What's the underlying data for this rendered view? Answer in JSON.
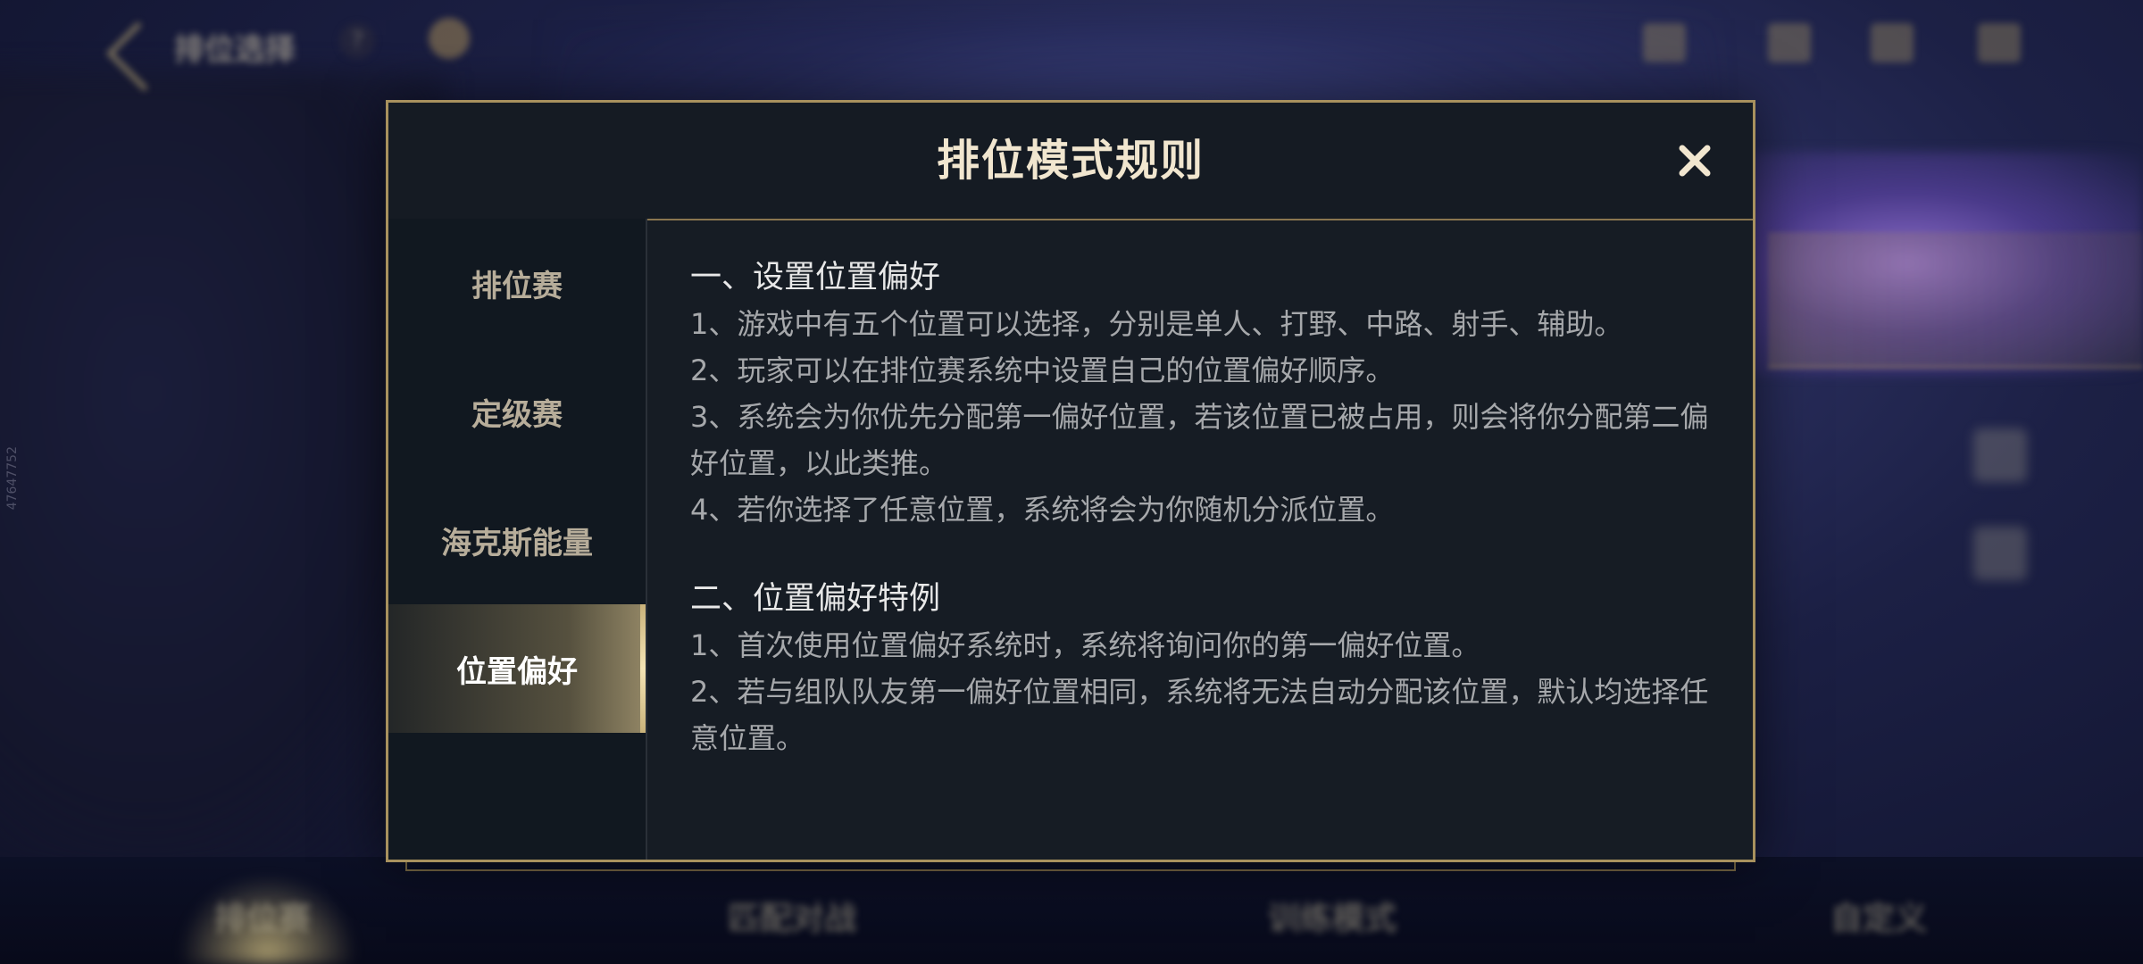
{
  "background": {
    "top_bar": {
      "title": "排位选择",
      "help_label": "?"
    },
    "bottom_nav": [
      "排位赛",
      "匹配对战",
      "训练模式",
      "自定义"
    ],
    "side_id": "47647752"
  },
  "modal": {
    "title": "排位模式规则",
    "close_icon": "close-icon",
    "tabs": [
      {
        "label": "排位赛"
      },
      {
        "label": "定级赛"
      },
      {
        "label": "海克斯能量"
      },
      {
        "label": "位置偏好"
      }
    ],
    "active_tab": "位置偏好",
    "sections": [
      {
        "heading": "一、设置位置偏好",
        "lines": [
          "1、游戏中有五个位置可以选择，分别是单人、打野、中路、射手、辅助。",
          "2、玩家可以在排位赛系统中设置自己的位置偏好顺序。",
          "3、系统会为你优先分配第一偏好位置，若该位置已被占用，则会将你分配第二偏好位置，以此类推。",
          "4、若你选择了任意位置，系统将会为你随机分派位置。"
        ]
      },
      {
        "heading": "二、位置偏好特例",
        "lines": [
          "1、首次使用位置偏好系统时，系统将询问你的第一偏好位置。",
          "2、若与组队队友第一偏好位置相同，系统将无法自动分配该位置，默认均选择任意位置。"
        ]
      }
    ]
  },
  "colors": {
    "accent_gold": "#a8915e",
    "title_text": "#f1e6cf",
    "body_text": "#a6a8ab",
    "modal_bg": "#161c24"
  }
}
